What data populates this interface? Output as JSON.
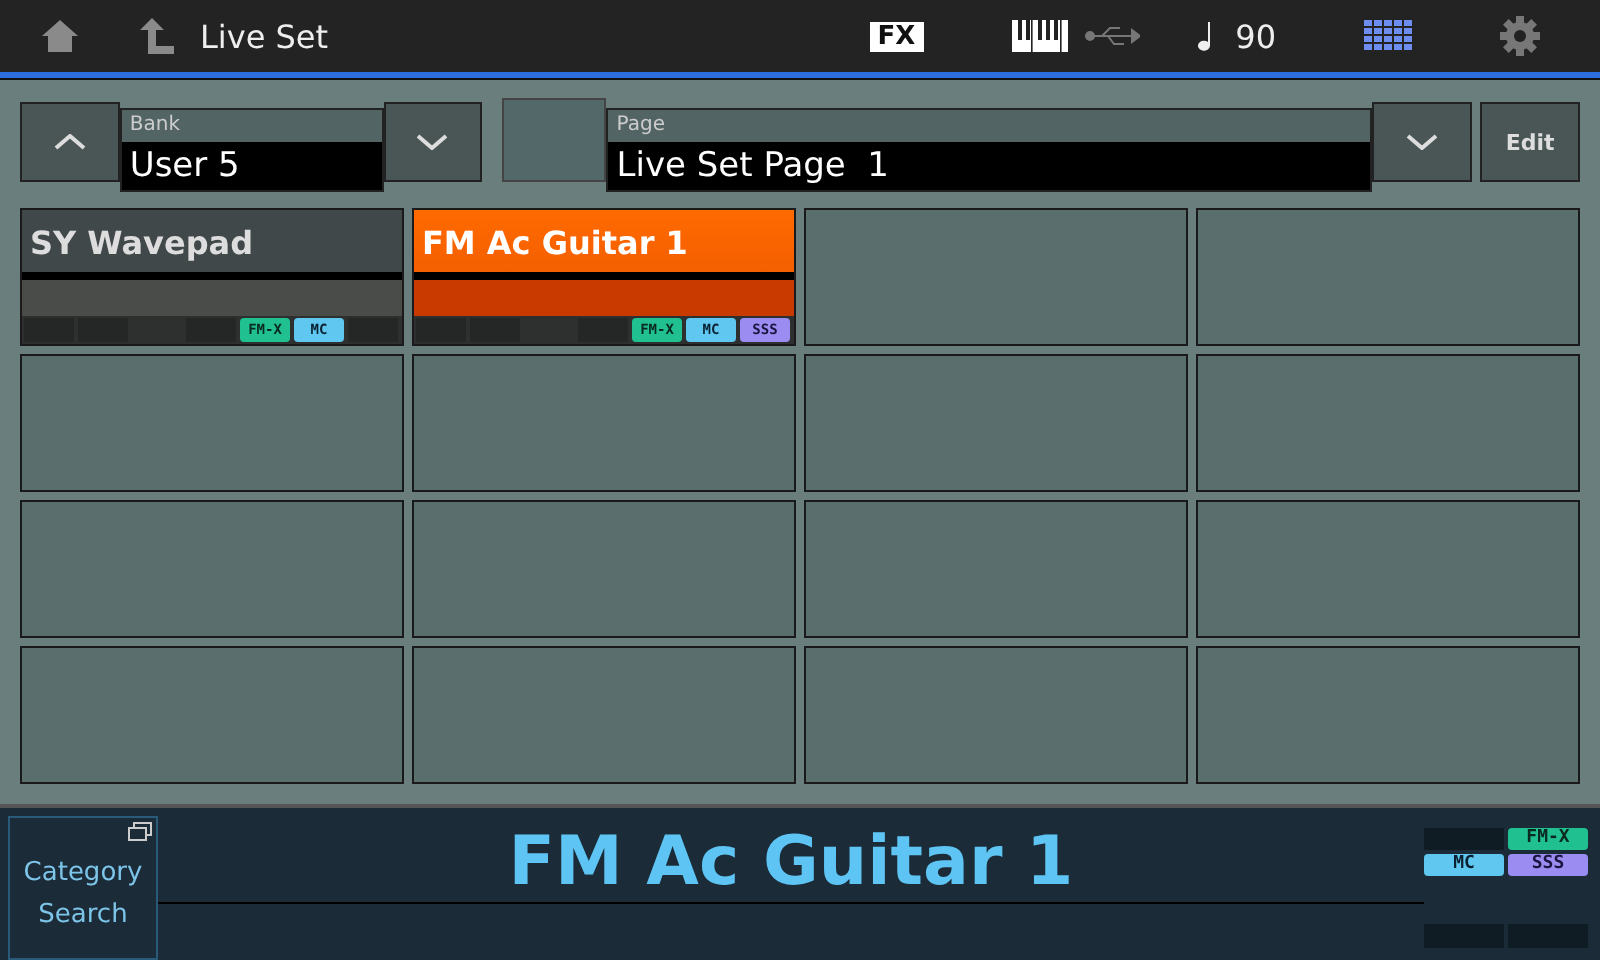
{
  "header": {
    "title": "Live Set",
    "fx": "FX",
    "tempo": "90"
  },
  "bank": {
    "label": "Bank",
    "value": "User 5"
  },
  "page": {
    "label": "Page",
    "value": "Live Set Page  1"
  },
  "edit_button": "Edit",
  "slots": [
    {
      "name": "SY Wavepad",
      "selected": false,
      "tags": [
        {
          "kind": "fmx",
          "text": "FM-X"
        },
        {
          "kind": "mc",
          "text": "MC"
        }
      ]
    },
    {
      "name": "FM Ac Guitar 1",
      "selected": true,
      "tags": [
        {
          "kind": "fmx",
          "text": "FM-X"
        },
        {
          "kind": "mc",
          "text": "MC"
        },
        {
          "kind": "sss",
          "text": "SSS"
        }
      ]
    },
    {
      "selected": false
    },
    {
      "selected": false
    },
    {
      "selected": false
    },
    {
      "selected": false
    },
    {
      "selected": false
    },
    {
      "selected": false
    },
    {
      "selected": false
    },
    {
      "selected": false
    },
    {
      "selected": false
    },
    {
      "selected": false
    },
    {
      "selected": false
    },
    {
      "selected": false
    },
    {
      "selected": false
    },
    {
      "selected": false
    }
  ],
  "category_search": "Category Search",
  "current": {
    "name": "FM Ac Guitar 1",
    "tags": [
      {
        "kind": "fmx",
        "text": "FM-X"
      },
      {
        "kind": "mc",
        "text": "MC"
      },
      {
        "kind": "sss",
        "text": "SSS"
      }
    ]
  }
}
